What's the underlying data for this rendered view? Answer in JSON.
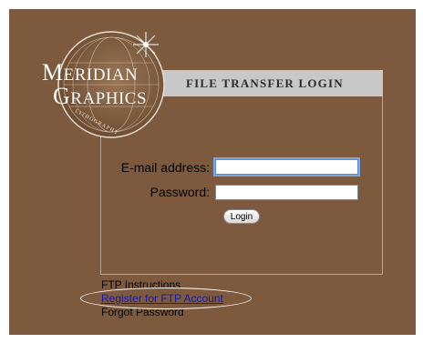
{
  "logo": {
    "line1": "Meridian",
    "line2": "Graphics",
    "subtitle": "LITHOGRAPHY"
  },
  "header": {
    "title": "FILE TRANSFER LOGIN"
  },
  "form": {
    "email_label": "E-mail address:",
    "email_value": "",
    "password_label": "Password:",
    "password_value": "",
    "login_label": "Login"
  },
  "links": {
    "ftp_instructions": "FTP Instructions",
    "register": "Register for FTP Account",
    "forgot_password": "Forgot Password"
  },
  "colors": {
    "background": "#7d5a3d",
    "title_bar": "#c8c8c8",
    "link": "#1a1aa8"
  }
}
